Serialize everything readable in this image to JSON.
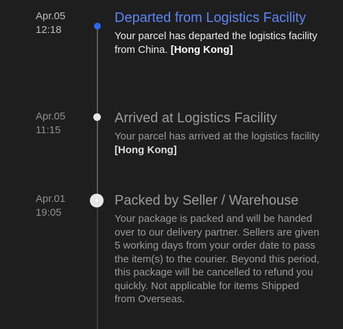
{
  "events": [
    {
      "date": "Apr.05",
      "time": "12:18",
      "title": "Departed from Logistics Facility",
      "description": "Your parcel has departed the logistics facility from China. ",
      "location": "[Hong Kong]",
      "status": "current",
      "dot_color": "#2f66f0",
      "title_color": "#5e86f5"
    },
    {
      "date": "Apr.05",
      "time": "11:15",
      "title": "Arrived at Logistics Facility",
      "description": "Your parcel has arrived at the logistics facility ",
      "location": "[Hong Kong]",
      "status": "past"
    },
    {
      "date": "Apr.01",
      "time": "19:05",
      "title": "Packed by Seller / Warehouse",
      "description": "Your package is packed and will be handed over to our delivery partner. Sellers are given 5 working days from your order date to pass the item(s) to the courier. Beyond this period, this package will be cancelled to refund you quickly. Not applicable for items Shipped from Overseas.",
      "status": "first"
    }
  ]
}
